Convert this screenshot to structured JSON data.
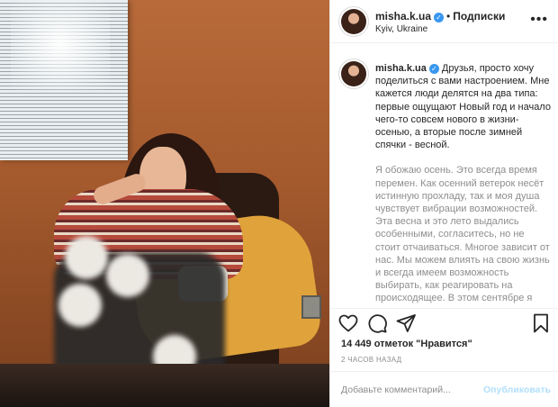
{
  "post": {
    "username": "misha.k.ua",
    "verified_icon": "verified-check-icon",
    "separator": "•",
    "follow_label": "Подписки",
    "location": "Kyiv, Ukraine",
    "more_icon": "ellipsis-icon",
    "more_label": "•••"
  },
  "caption": {
    "username": "misha.k.ua",
    "paragraph1": "Друзья, просто хочу поделиться с вами настроением. Мне кажется люди делятся на два типа: первые ощущают Новый год и начало чего-то совсем нового в жизни- осенью, а вторые после зимней спячки - весной.",
    "paragraph2": "Я обожаю осень. Это всегда время перемен. Как осенний ветерок несёт истинную прохладу, так и моя душа чувствует вибрации возможностей. Эта весна и это лето выдались особенными, согласитесь, но не стоит отчаиваться. Многое зависит от нас. Мы можем влиять на свою жизнь и всегда имеем возможность выбирать, как реагировать на происходящее. В этом сентябре я выбираю открыться новым людям."
  },
  "actions": {
    "like_icon": "heart-icon",
    "comment_icon": "comment-bubble-icon",
    "share_icon": "paper-plane-icon",
    "save_icon": "bookmark-icon"
  },
  "likes": "14 449 отметок \"Нравится\"",
  "time_ago": "2 ЧАСОВ НАЗАД",
  "comment_box": {
    "placeholder": "Добавьте комментарий...",
    "publish_label": "Опубликовать"
  },
  "colors": {
    "accent": "#3897f0",
    "publish_disabled": "#b2dffc",
    "secondary_text": "#8e8e8e"
  }
}
